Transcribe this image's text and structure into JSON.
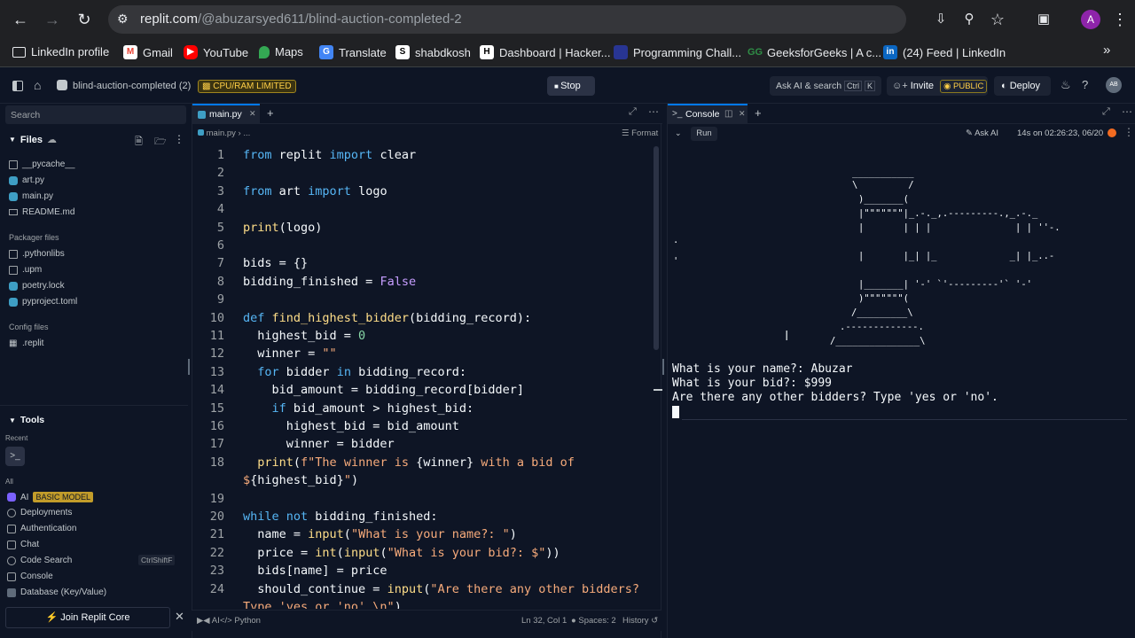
{
  "browser": {
    "url_host": "replit.com",
    "url_path": "/@abuzarsyed611/blind-auction-completed-2",
    "profile_initial": "A",
    "bookmarks": [
      {
        "label": "LinkedIn profile",
        "icon": "folder-icon"
      },
      {
        "label": "Gmail",
        "icon": "gmail-icon"
      },
      {
        "label": "YouTube",
        "icon": "youtube-icon"
      },
      {
        "label": "Maps",
        "icon": "maps-icon"
      },
      {
        "label": "Translate",
        "icon": "translate-icon"
      },
      {
        "label": "shabdkosh",
        "icon": "shabdkosh-icon"
      },
      {
        "label": "Dashboard | Hacker...",
        "icon": "hackerrank-icon"
      },
      {
        "label": "Programming Chall...",
        "icon": "programming-icon"
      },
      {
        "label": "GeeksforGeeks | A c...",
        "icon": "gfg-icon"
      },
      {
        "label": "(24) Feed | LinkedIn",
        "icon": "linkedin-icon"
      }
    ]
  },
  "header": {
    "repl_name": "blind-auction-completed (2)",
    "limit_badge": "CPU/RAM LIMITED",
    "stop_label": "Stop",
    "ask_ai": "Ask AI & search",
    "ask_ai_shortcut_1": "Ctrl",
    "ask_ai_shortcut_2": "K",
    "invite_label": "Invite",
    "public_label": "PUBLIC",
    "deploy_label": "Deploy",
    "avatar_initials": "AB"
  },
  "sidebar": {
    "search_placeholder": "Search",
    "files_title": "Files",
    "files": [
      "__pycache__",
      "art.py",
      "main.py",
      "README.md"
    ],
    "packager_title": "Packager files",
    "packager_files": [
      ".pythonlibs",
      ".upm",
      "poetry.lock",
      "pyproject.toml"
    ],
    "config_title": "Config files",
    "config_files": [
      ".replit"
    ],
    "tools_title": "Tools",
    "recent_title": "Recent",
    "all_title": "All",
    "ai_label": "AI",
    "ai_badge": "BASIC MODEL",
    "tools": [
      "Deployments",
      "Authentication",
      "Chat",
      "Code Search",
      "Console",
      "Database (Key/Value)"
    ],
    "code_search_shortcut": "CtrlShiftF",
    "join_core": "Join Replit Core"
  },
  "editor": {
    "tab_label": "main.py",
    "breadcrumb": "main.py",
    "breadcrumb_more": "...",
    "format_label": "Format",
    "status_ai": "AI",
    "status_lang": "Python",
    "status_pos": "Ln 32, Col 1",
    "status_spaces": "Spaces: 2",
    "status_history": "History"
  },
  "console": {
    "tab_label": "Console",
    "run_label": "Run",
    "ask_ai": "Ask AI",
    "timestamp": "14s on 02:26:23, 06/20",
    "output": [
      "What is your name?: Abuzar",
      "What is your bid?: $999",
      "Are there any other bidders? Type 'yes or 'no'."
    ]
  }
}
